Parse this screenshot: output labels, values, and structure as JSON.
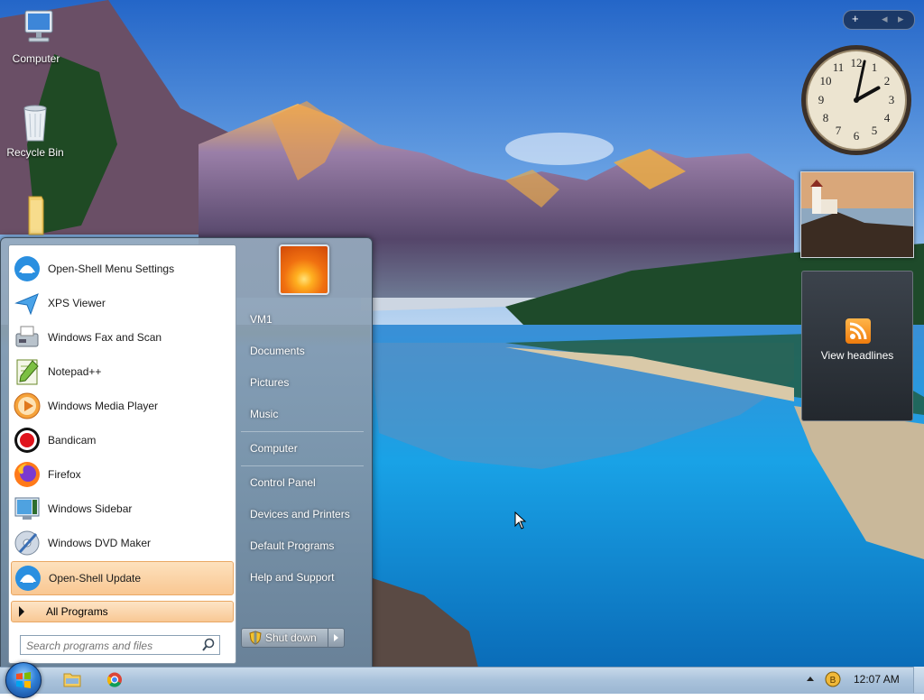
{
  "desktop": {
    "icons": [
      {
        "label": "Computer",
        "icon": "computer-icon"
      },
      {
        "label": "Recycle Bin",
        "icon": "recycle-bin-icon"
      },
      {
        "label": "",
        "icon": "folder-icon"
      }
    ]
  },
  "gadgets": {
    "toolbar": {
      "add": "+",
      "prev": "◂",
      "next": "▸"
    },
    "clock": {
      "hour": 2,
      "minute": 2
    },
    "feed": {
      "label": "View headlines",
      "icon": "rss-icon"
    }
  },
  "start_menu": {
    "programs": [
      {
        "label": "Open-Shell Menu Settings",
        "icon": "open-shell-icon"
      },
      {
        "label": "XPS Viewer",
        "icon": "xps-viewer-icon"
      },
      {
        "label": "Windows Fax and Scan",
        "icon": "fax-scan-icon"
      },
      {
        "label": "Notepad++",
        "icon": "notepad-plus-icon"
      },
      {
        "label": "Windows Media Player",
        "icon": "media-player-icon"
      },
      {
        "label": "Bandicam",
        "icon": "bandicam-icon"
      },
      {
        "label": "Firefox",
        "icon": "firefox-icon"
      },
      {
        "label": "Windows Sidebar",
        "icon": "sidebar-icon"
      },
      {
        "label": "Windows DVD Maker",
        "icon": "dvd-maker-icon"
      },
      {
        "label": "Open-Shell Update",
        "icon": "open-shell-icon",
        "highlighted": true
      }
    ],
    "all_programs": "All Programs",
    "search_placeholder": "Search programs and files",
    "right_items": [
      "VM1",
      "Documents",
      "Pictures",
      "Music",
      "Computer",
      "Control Panel",
      "Devices and Printers",
      "Default Programs",
      "Help and Support"
    ],
    "shutdown_label": "Shut down"
  },
  "taskbar": {
    "pinned": [
      {
        "name": "explorer",
        "icon": "folder-icon"
      },
      {
        "name": "chrome",
        "icon": "chrome-icon"
      }
    ],
    "clock": "12:07 AM"
  },
  "colors": {
    "highlight": "#f9c792",
    "taskbar": "#a9c2db",
    "menu_frame": "#8296aa"
  }
}
